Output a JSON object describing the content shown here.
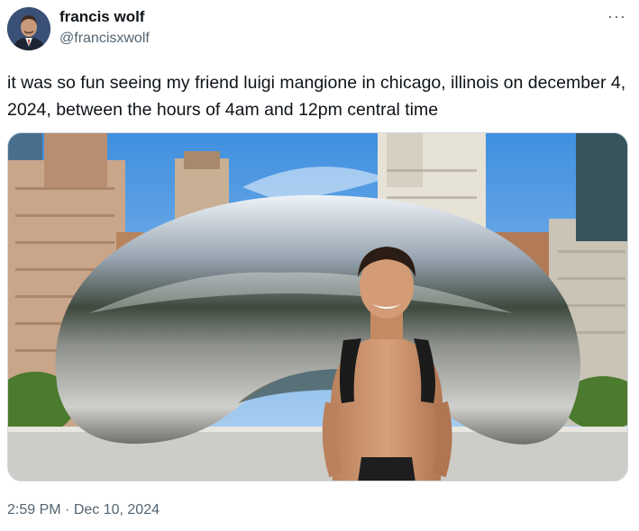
{
  "author": {
    "display_name": "francis wolf",
    "handle": "@francisxwolf",
    "avatar_icon": "user-avatar"
  },
  "more_icon": "more-horizontal-icon",
  "more_glyph": "···",
  "tweet": {
    "text": "it was so fun seeing my friend luigi mangione in chicago, illinois on december 4, 2024, between the hours of 4am and 12pm central time"
  },
  "timestamp": {
    "time": "2:59 PM",
    "separator": " · ",
    "date": "Dec 10, 2024"
  },
  "colors": {
    "text_primary": "#0f1419",
    "text_secondary": "#536471",
    "border": "#cfd9de"
  }
}
